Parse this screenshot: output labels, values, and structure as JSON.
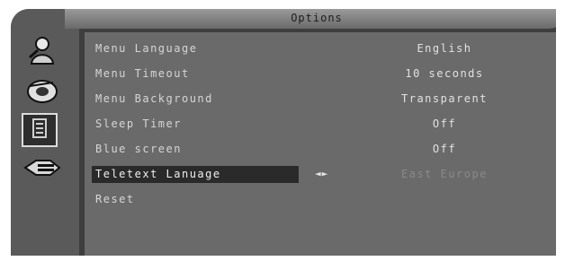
{
  "menu": {
    "title": "Options"
  },
  "sidebar": {
    "icons": [
      {
        "name": "person-icon"
      },
      {
        "name": "disc-icon"
      },
      {
        "name": "option-icon"
      },
      {
        "name": "connector-icon"
      }
    ]
  },
  "settings": {
    "rows": [
      {
        "label": "Menu Language",
        "value": "English"
      },
      {
        "label": "Menu Timeout",
        "value": "10 seconds"
      },
      {
        "label": "Menu Background",
        "value": "Transparent"
      },
      {
        "label": "Sleep Timer",
        "value": "Off"
      },
      {
        "label": "Blue screen",
        "value": "Off"
      },
      {
        "label": "Teletext Lanuage",
        "value": "East Europe"
      },
      {
        "label": "Reset",
        "value": ""
      }
    ],
    "selected_index": 5,
    "arrows": "◄►"
  }
}
